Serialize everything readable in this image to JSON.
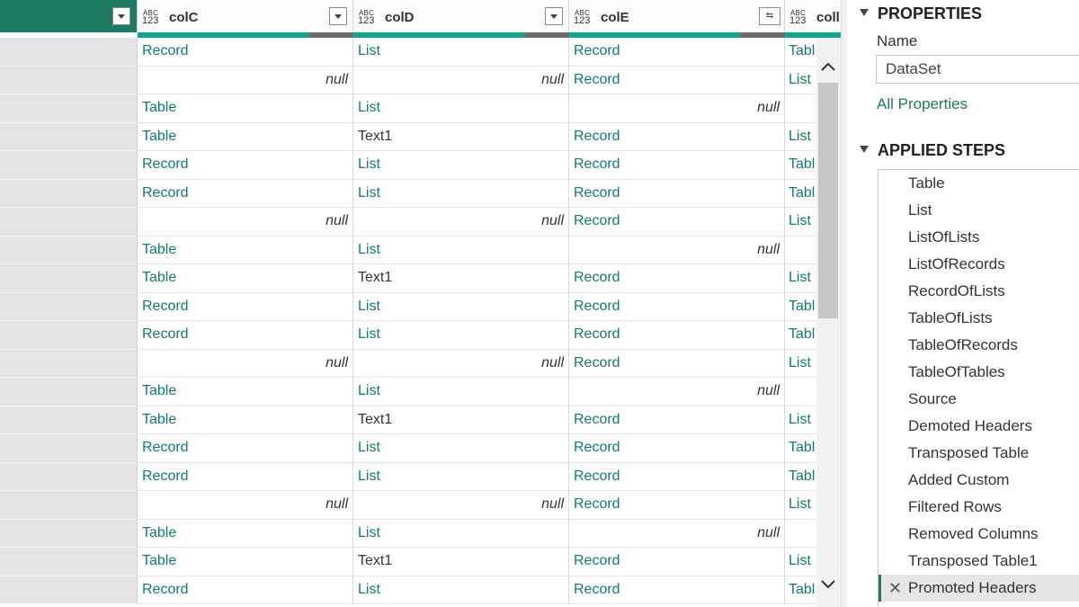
{
  "grid": {
    "columns": [
      {
        "name": "colC",
        "type_icon_top": "ABC",
        "type_icon_bottom": "123",
        "valid_pct": 80
      },
      {
        "name": "colD",
        "type_icon_top": "ABC",
        "type_icon_bottom": "123",
        "valid_pct": 80
      },
      {
        "name": "colE",
        "type_icon_top": "ABC",
        "type_icon_bottom": "123",
        "valid_pct": 80
      },
      {
        "name": "coll",
        "type_icon_top": "ABC",
        "type_icon_bottom": "123"
      }
    ],
    "rows": [
      [
        "Record",
        "List",
        "Record",
        "Tabl"
      ],
      [
        "null",
        "null",
        "Record",
        "List"
      ],
      [
        "Table",
        "List",
        "null",
        ""
      ],
      [
        "Table",
        "Text1",
        "Record",
        "List"
      ],
      [
        "Record",
        "List",
        "Record",
        "Tabl"
      ],
      [
        "Record",
        "List",
        "Record",
        "Tabl"
      ],
      [
        "null",
        "null",
        "Record",
        "List"
      ],
      [
        "Table",
        "List",
        "null",
        ""
      ],
      [
        "Table",
        "Text1",
        "Record",
        "List"
      ],
      [
        "Record",
        "List",
        "Record",
        "Tabl"
      ],
      [
        "Record",
        "List",
        "Record",
        "Tabl"
      ],
      [
        "null",
        "null",
        "Record",
        "List"
      ],
      [
        "Table",
        "List",
        "null",
        ""
      ],
      [
        "Table",
        "Text1",
        "Record",
        "List"
      ],
      [
        "Record",
        "List",
        "Record",
        "Tabl"
      ],
      [
        "Record",
        "List",
        "Record",
        "Tabl"
      ],
      [
        "null",
        "null",
        "Record",
        "List"
      ],
      [
        "Table",
        "List",
        "null",
        ""
      ],
      [
        "Table",
        "Text1",
        "Record",
        "List"
      ],
      [
        "Record",
        "List",
        "Record",
        "Tabl"
      ]
    ]
  },
  "properties": {
    "title": "PROPERTIES",
    "name_label": "Name",
    "name_value": "DataSet",
    "all_properties_link": "All Properties"
  },
  "applied_steps": {
    "title": "APPLIED STEPS",
    "steps": [
      "Table",
      "List",
      "ListOfLists",
      "ListOfRecords",
      "RecordOfLists",
      "TableOfLists",
      "TableOfRecords",
      "TableOfTables",
      "Source",
      "Demoted Headers",
      "Transposed Table",
      "Added Custom",
      "Filtered Rows",
      "Removed Columns",
      "Transposed Table1",
      "Promoted Headers"
    ],
    "selected_step": "Promoted Headers"
  },
  "colors": {
    "accent": "#1e7a60",
    "quality_valid": "#14a38b",
    "quality_empty": "#6e6e6e",
    "cell_text": "#127b6a"
  }
}
